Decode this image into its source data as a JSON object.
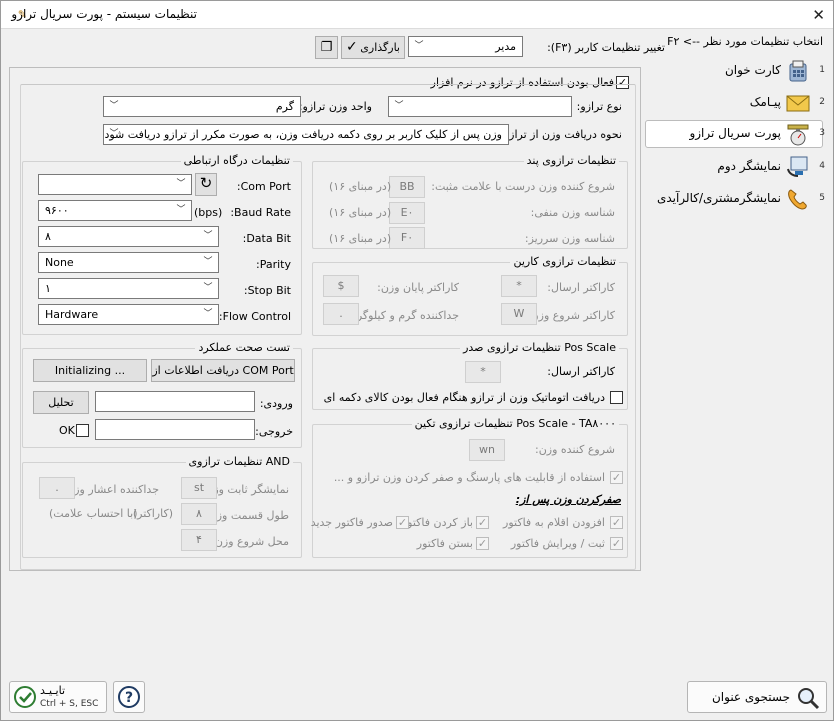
{
  "window": {
    "title": "تنظیمات سیستم - پورت سریال ترازو",
    "close_icon": "close-icon"
  },
  "sidebar": {
    "header": "F۲ <-- انتخاب تنظیمات مورد نظر",
    "items": [
      {
        "num": "1",
        "label": "کارت خوان",
        "icon": "card-reader-icon"
      },
      {
        "num": "2",
        "label": "پیـامک",
        "icon": "envelope-icon"
      },
      {
        "num": "3",
        "label": "پورت سریال ترازو",
        "icon": "scale-icon",
        "active": true
      },
      {
        "num": "4",
        "label": "نمایشگر دوم",
        "icon": "second-display-icon"
      },
      {
        "num": "5",
        "label": "نمایشگرمشتری/کالرآیدی",
        "icon": "phone-icon"
      }
    ]
  },
  "toolbar": {
    "user_settings_label": "تغییر تنظیمات کاربر (F۳):",
    "user_value": "مدیر",
    "reload_label": "بارگذاری"
  },
  "enable": {
    "label": "فعال بودن استفاده از ترازو در نرم افزار",
    "checked": true
  },
  "scale_type": {
    "label": "نوع ترازو:",
    "value": ""
  },
  "weight_unit": {
    "label": "واحد وزن ترازو:",
    "value": "گرم"
  },
  "receive": {
    "label": "نحوه دریافت وزن از ترازو:",
    "value": "وزن پس از کلیک کاربر بر روی دکمه دریافت وزن، به صورت مکرر از ترازو دریافت شود"
  },
  "comm": {
    "title": "تنظیمات درگاه ارتباطی",
    "com_port": {
      "label": "Com Port:",
      "value": ""
    },
    "baud": {
      "label": "Baud Rate:",
      "unit": "(bps)",
      "value": "۹۶۰۰"
    },
    "data_bit": {
      "label": "Data Bit:",
      "value": "۸"
    },
    "parity": {
      "label": "Parity:",
      "value": "None"
    },
    "stop_bit": {
      "label": "Stop Bit:",
      "value": "۱"
    },
    "flow": {
      "label": "Flow Control:",
      "value": "Hardware"
    }
  },
  "test": {
    "title": "تست صحت عملکرد",
    "fetch_btn": "دریافت اطلاعات از COM Port",
    "init_btn": "Initializing ...",
    "input_label": "ورودی:",
    "analyze_btn": "تحلیل",
    "output_label": "خروجی:",
    "ok_label": "OK"
  },
  "and": {
    "title": "تنظیمات ترازوی AND",
    "fixed_label": "نمایشگر ثابت وزن:",
    "fixed_value": "st",
    "decimal_label": "جداکننده اعشار وزن:",
    "decimal_value": ".",
    "length_label": "طول قسمت وزن:",
    "length_value": "۸",
    "length_unit": "(کاراکتر)",
    "length_note": "(با احتساب علامت)",
    "start_label": "محل شروع وزن:",
    "start_value": "۴"
  },
  "pand": {
    "title": "تنظیمات ترازوی پند",
    "start_pos_label": "شروع کننده وزن درست با علامت مثبت:",
    "start_pos_value": "BB",
    "hex_note": "(در مبنای ۱۶)",
    "neg_label": "شناسه وزن منفی:",
    "neg_value": "E۰",
    "over_label": "شناسه وزن سرریز:",
    "over_value": "F۰"
  },
  "karin": {
    "title": "تنظیمات ترازوی کارین",
    "send_label": "کاراکتر ارسال:",
    "send_value": "*",
    "end_label": "کاراکتر پایان وزن:",
    "end_value": "$",
    "start_label": "کاراکتر شروع وزن:",
    "start_value": "W",
    "sep_label": "جداکننده گرم و کیلوگرم:",
    "sep_value": "."
  },
  "posscale": {
    "title": "تنظیمات ترازوی صدر Pos Scale",
    "send_label": "کاراکتر ارسال:",
    "send_value": "*",
    "auto_label": "دریافت اتوماتیک وزن از ترازو هنگام فعال بودن کالای دکمه ای"
  },
  "takin": {
    "title": "تنظیمات ترازوی تکین Pos Scale - TA۸۰۰۰",
    "start_label": "شروع کننده وزن:",
    "start_value": "wn",
    "parsing_label": "استفاده از قابلیت های پارسنگ و صفر کردن وزن ترازو و ...",
    "zero_title": "صفرکردن وزن پس از:",
    "opts": [
      "افزودن اقلام به فاکتور",
      "باز کردن فاکتور",
      "صدور فاکتور جدید",
      "ثبت / ویرایش فاکتور",
      "بستن فاکتور"
    ]
  },
  "footer": {
    "confirm_label": "تایـیـد",
    "confirm_shortcut": "Ctrl + S, ESC",
    "search_label": "جستجوی عنوان"
  }
}
